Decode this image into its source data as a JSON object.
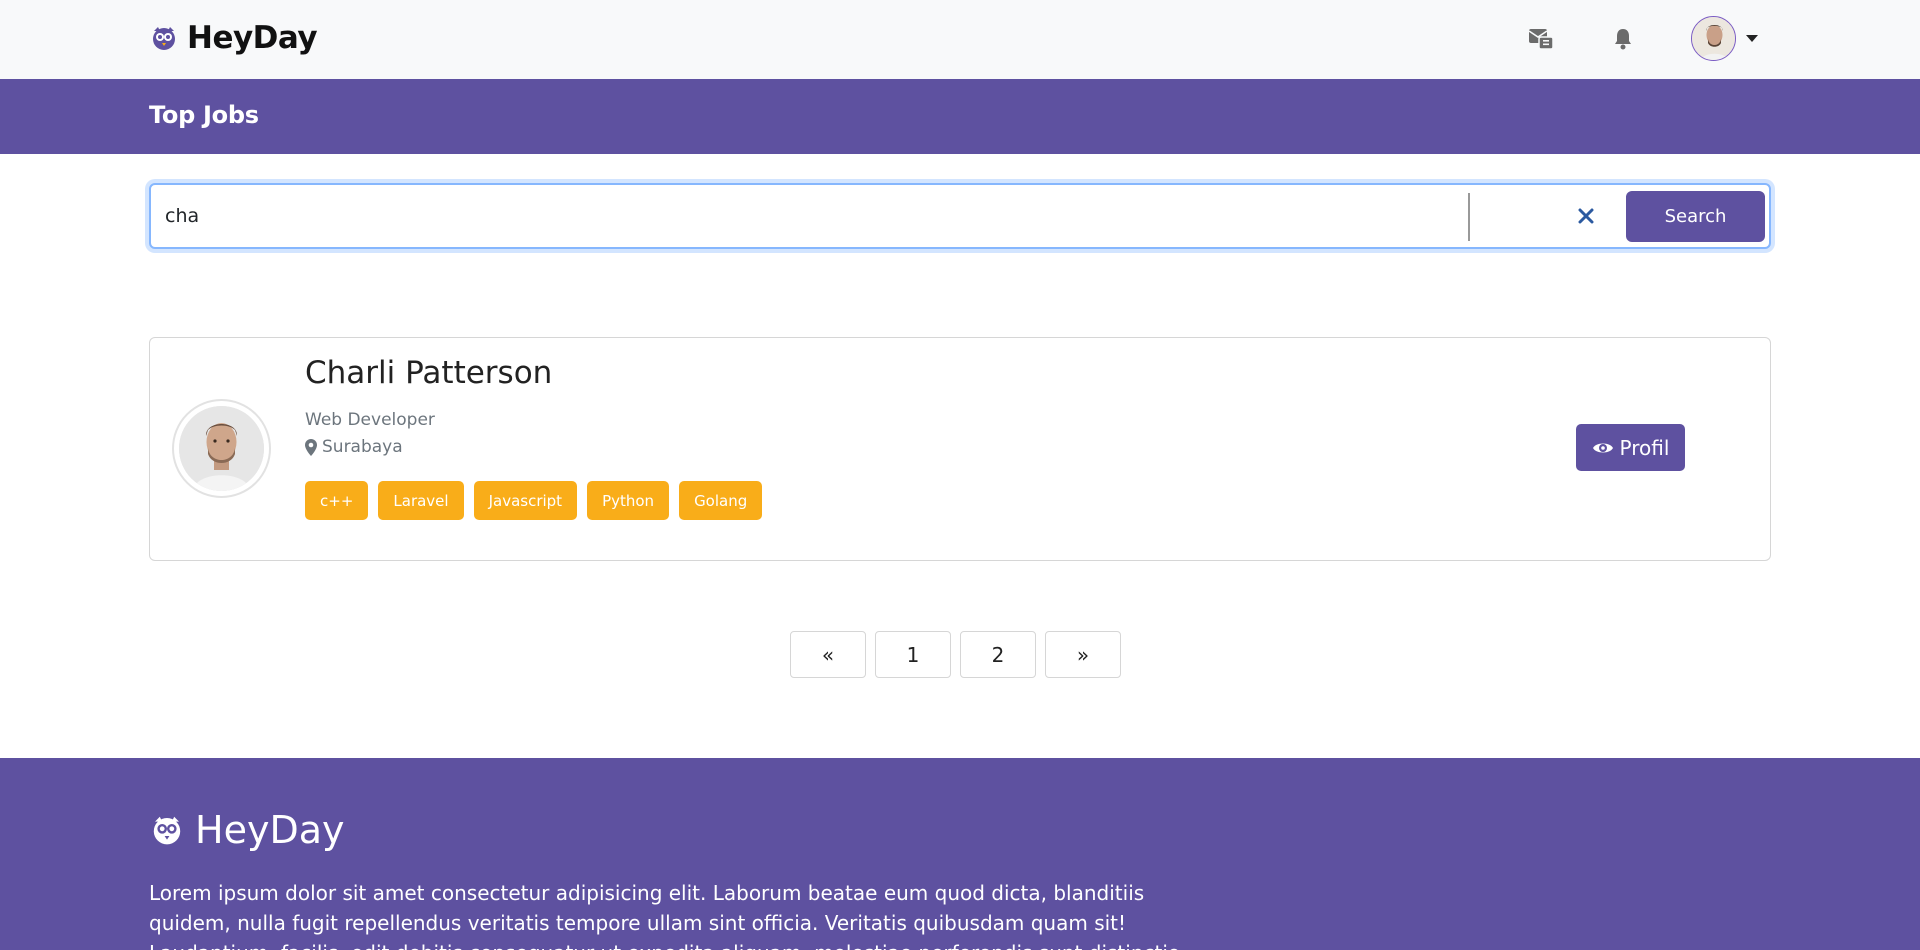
{
  "nav": {
    "brand": "HeyDay",
    "icons": {
      "messages": "messages-icon",
      "notifications": "bell-icon",
      "avatar": "user-avatar",
      "dropdown": "caret-down-icon"
    }
  },
  "header": {
    "title": "Top Jobs"
  },
  "search": {
    "value": "cha",
    "button_label": "Search",
    "clear_icon": "close-icon"
  },
  "results": [
    {
      "name": "Charli Patterson",
      "role": "Web Developer",
      "location": "Surabaya",
      "tags": [
        "c++",
        "Laravel",
        "Javascript",
        "Python",
        "Golang"
      ],
      "profile_button": "Profil"
    }
  ],
  "pagination": {
    "prev": "«",
    "pages": [
      "1",
      "2"
    ],
    "next": "»"
  },
  "footer": {
    "brand": "HeyDay",
    "text": "Lorem ipsum dolor sit amet consectetur adipisicing elit. Laborum beatae eum quod dicta, blanditiis quidem, nulla fugit repellendus veritatis tempore ullam sint officia. Veritatis quibusdam quam sit! Laudantium, facilis, odit debitis consequatur ut expedita aliquam, molestiae perferendis sunt distinctio"
  },
  "colors": {
    "primary": "#5e51a0",
    "tag": "#f9ad19",
    "navbar": "#f8f9fa",
    "focus_ring": "#86b7fe"
  }
}
